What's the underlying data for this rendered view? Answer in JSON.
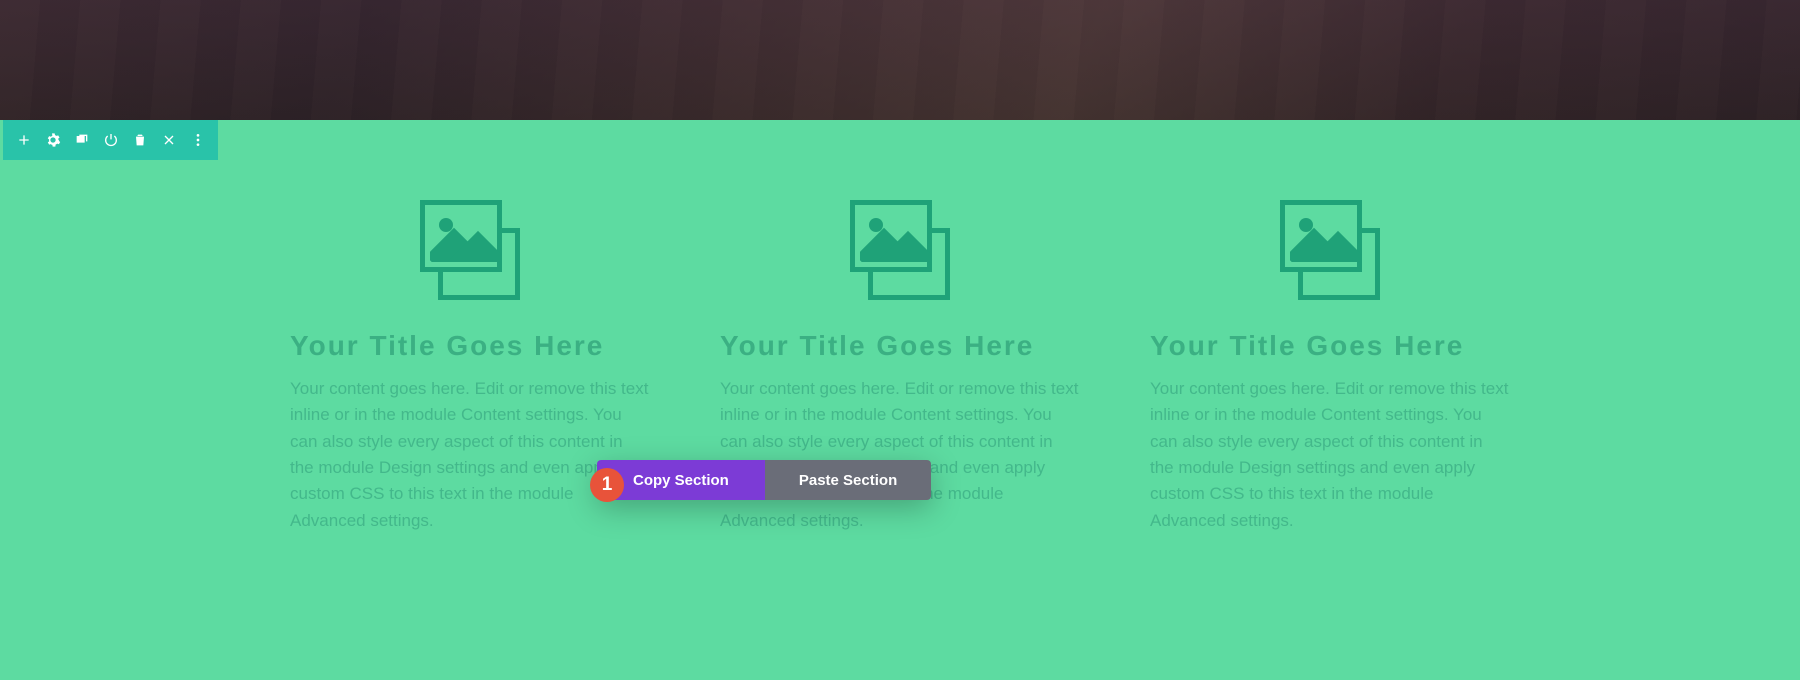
{
  "colors": {
    "section_bg": "#5ddba1",
    "toolbar_bg": "#29c3a9",
    "accent_purple": "#7c3bd6",
    "badge_bg": "#e8533a",
    "icon_color": "#1fa278",
    "title_color": "#3bb083",
    "body_color": "#43b88b",
    "paste_bg": "#6a6d78"
  },
  "toolbar": {
    "items": [
      {
        "name": "add-icon"
      },
      {
        "name": "gear-icon"
      },
      {
        "name": "window-icon"
      },
      {
        "name": "power-icon"
      },
      {
        "name": "trash-icon"
      },
      {
        "name": "close-icon"
      },
      {
        "name": "more-icon"
      }
    ]
  },
  "columns": [
    {
      "title": "Your Title Goes Here",
      "body": "Your content goes here. Edit or remove this text inline or in the module Content settings. You can also style every aspect of this content in the module Design settings and even apply custom CSS to this text in the module Advanced settings."
    },
    {
      "title": "Your Title Goes Here",
      "body": "Your content goes here. Edit or remove this text inline or in the module Content settings. You can also style every aspect of this content in the module Design settings and even apply custom CSS to this text in the module Advanced settings."
    },
    {
      "title": "Your Title Goes Here",
      "body": "Your content goes here. Edit or remove this text inline or in the module Content settings. You can also style every aspect of this content in the module Design settings and even apply custom CSS to this text in the module Advanced settings."
    }
  ],
  "context_menu": {
    "copy_label": "Copy Section",
    "paste_label": "Paste Section"
  },
  "badge": {
    "number": "1"
  }
}
